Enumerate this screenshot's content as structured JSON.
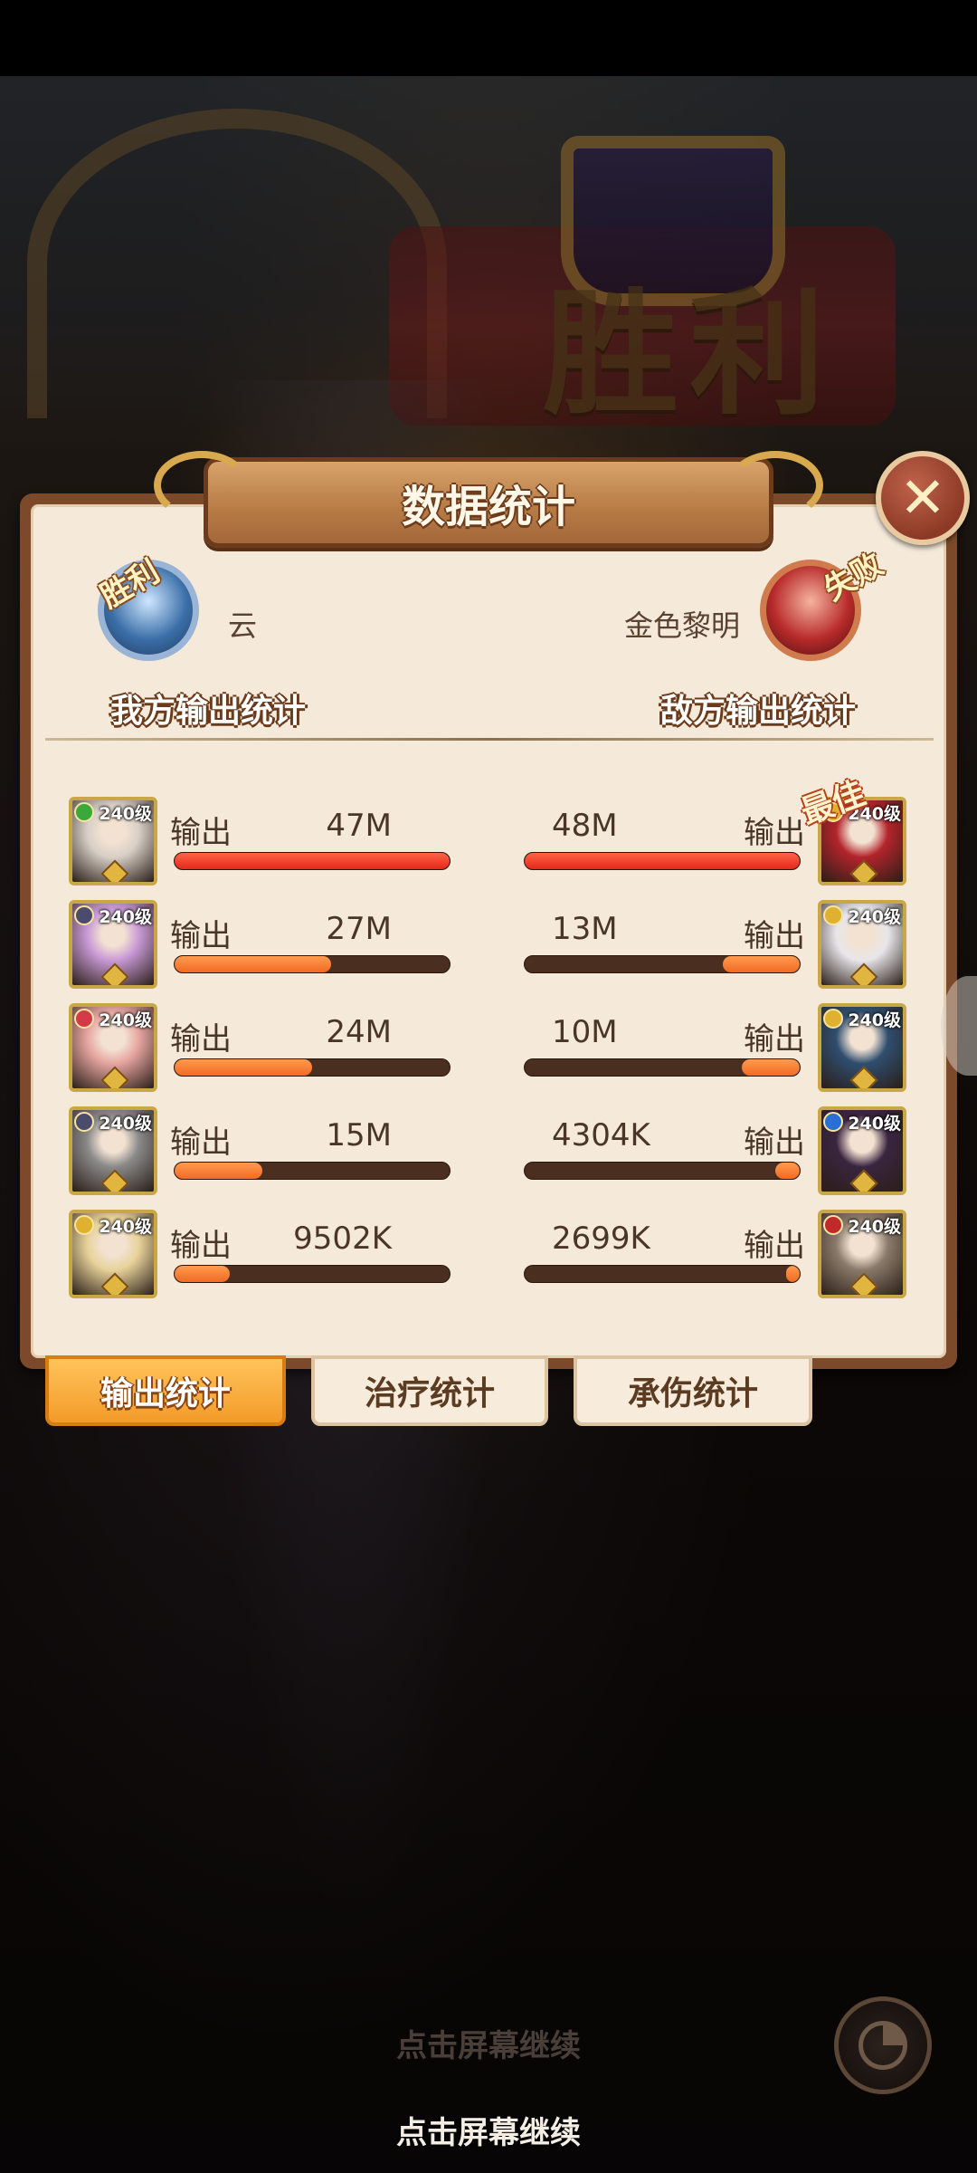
{
  "scene": {
    "victory_title": "胜利"
  },
  "panel": {
    "title": "数据统计",
    "close_icon": "close-icon",
    "ally": {
      "badge": "胜利",
      "name": "云",
      "section_label": "我方输出统计"
    },
    "enemy": {
      "badge": "失败",
      "name": "金色黎明",
      "section_label": "敌方输出统计"
    },
    "best_badge": "最佳",
    "rows": [
      {
        "left": {
          "level": "240级",
          "label": "输出",
          "value": "47M",
          "fraction": 1.0
        },
        "right": {
          "level": "240级",
          "label": "输出",
          "value": "48M",
          "fraction": 1.0
        }
      },
      {
        "left": {
          "level": "240级",
          "label": "输出",
          "value": "27M",
          "fraction": 0.57
        },
        "right": {
          "level": "240级",
          "label": "输出",
          "value": "13M",
          "fraction": 0.28
        }
      },
      {
        "left": {
          "level": "240级",
          "label": "输出",
          "value": "24M",
          "fraction": 0.5
        },
        "right": {
          "level": "240级",
          "label": "输出",
          "value": "10M",
          "fraction": 0.21
        }
      },
      {
        "left": {
          "level": "240级",
          "label": "输出",
          "value": "15M",
          "fraction": 0.32
        },
        "right": {
          "level": "240级",
          "label": "输出",
          "value": "4304K",
          "fraction": 0.09
        }
      },
      {
        "left": {
          "level": "240级",
          "label": "输出",
          "value": "9502K",
          "fraction": 0.2
        },
        "right": {
          "level": "240级",
          "label": "输出",
          "value": "2699K",
          "fraction": 0.05
        }
      }
    ],
    "portrait_colors": {
      "left": [
        "#d8cfc6",
        "#c99ad6",
        "#e6a5a0",
        "#8a8a8a",
        "#e8d29a"
      ],
      "right": [
        "#b3242b",
        "#e8e6ea",
        "#2f4e6f",
        "#3a2540",
        "#8a7a6a"
      ]
    },
    "element_colors": {
      "left": [
        "#3aa83a",
        "#4b4b6b",
        "#d33a4a",
        "#4b4b6b",
        "#e0b030"
      ],
      "right": [
        "#e0b030",
        "#e0b030",
        "#e0b030",
        "#2a6fd6",
        "#c02a2a"
      ]
    }
  },
  "tabs": [
    {
      "label": "输出统计",
      "active": true
    },
    {
      "label": "治疗统计",
      "active": false
    },
    {
      "label": "承伤统计",
      "active": false
    }
  ],
  "bottom": {
    "continue_ghost": "点击屏幕继续",
    "continue_main": "点击屏幕继续",
    "stats_icon": "pie-chart-icon"
  },
  "colors": {
    "accent_orange": "#f39b28",
    "bar_fill": "#f26a24",
    "bar_top": "#e5281b",
    "panel_bg": "#f5eada"
  }
}
